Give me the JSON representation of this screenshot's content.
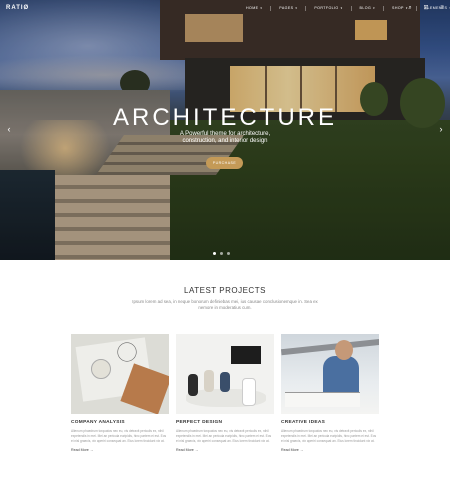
{
  "nav": {
    "logo": "RATIØ",
    "menu": [
      {
        "label": "HOME"
      },
      {
        "label": "PAGES"
      },
      {
        "label": "PORTFOLIO"
      },
      {
        "label": "BLOG"
      },
      {
        "label": "SHOP"
      },
      {
        "label": "ELEMENTS"
      }
    ],
    "caret": "▾",
    "search_glyph": "⌕",
    "cart_glyph": "⊡",
    "menu_glyph": "≡"
  },
  "hero": {
    "title": "ARCHITECTURE",
    "subtitle_line1": "A Powerful theme for architecture,",
    "subtitle_line2": "construction, and interior design",
    "button_label": "PURCHASE",
    "prev_arrow": "‹",
    "next_arrow": "›",
    "slides": 3,
    "active_slide": 1
  },
  "projects": {
    "title": "LATEST PROJECTS",
    "description": "Ipsum lorem ad sea, in neque bonorum definiebas mei, ius causae conclusionemque in. Sea ex nemore in moderatius cum.",
    "cards": [
      {
        "title": "COMPANY ANALYSIS",
        "text": "Alienum phaedrum torquatos nec eu, vis detraxit periculis ex, nihil expetendis in mei. Mei an pericula euripidis, hinc partem ei est. Eos ei nisl graecis, vix aperiri consequat an. Eius lorem tincidunt vix at.",
        "more": "Read More →"
      },
      {
        "title": "PERFECT DESIGN",
        "text": "Alienum phaedrum torquatos nec eu, vis detraxit periculis ex, nihil expetendis in mei. Mei an pericula euripidis, hinc partem ei est. Eos ei nisl graecis, vix aperiri consequat an. Eius lorem tincidunt vix at.",
        "more": "Read More →"
      },
      {
        "title": "CREATIVE IDEAS",
        "text": "Alienum phaedrum torquatos nec eu, vis detraxit periculis ex, nihil expetendis in mei. Mei an pericula euripidis, hinc partem ei est. Eos ei nisl graecis, vix aperiri consequat an. Eius lorem tincidunt vix at.",
        "more": "Read More →"
      }
    ]
  },
  "colors": {
    "accent": "#c49a57",
    "text_dark": "#333333",
    "text_muted": "#999999"
  }
}
